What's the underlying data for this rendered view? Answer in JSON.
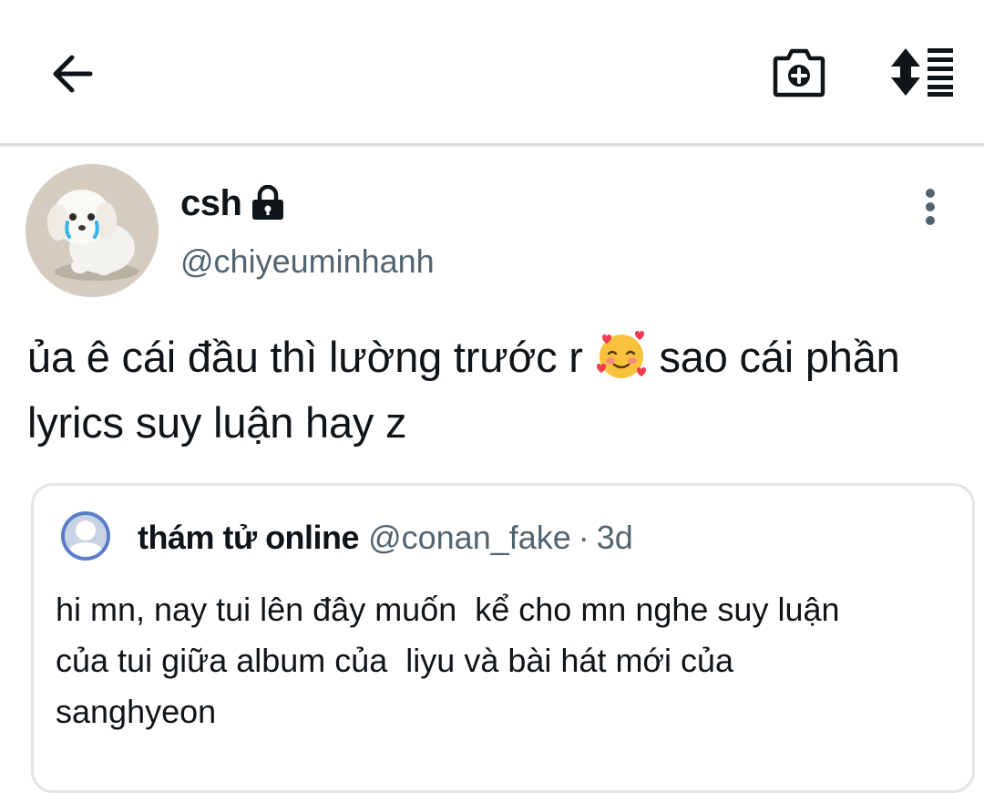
{
  "header": {
    "back_icon": "arrow-left-icon",
    "camera_icon": "camera-add-icon",
    "sort_icon": "sort-list-icon"
  },
  "post": {
    "display_name": "csh",
    "handle": "@chiyeuminhanh",
    "text_before_emoji": "ủa ê cái đầu thì lường trước r ",
    "emoji": "🥰",
    "text_after_emoji": " sao cái phần lyrics suy luận hay z",
    "more_icon": "more-vertical-icon",
    "lock_icon": "lock-icon"
  },
  "quote": {
    "display_name": "thám tử online",
    "handle": "@conan_fake",
    "separator": "·",
    "time": "3d",
    "text": "hi mn, nay tui lên đây muốn  kể cho mn nghe suy luận\ncủa tui giữa album của  liyu và bài hát mới của\nsanghyeon"
  },
  "colors": {
    "text_primary": "#0f1419",
    "text_secondary": "#536471",
    "border": "#e1e6ea"
  }
}
